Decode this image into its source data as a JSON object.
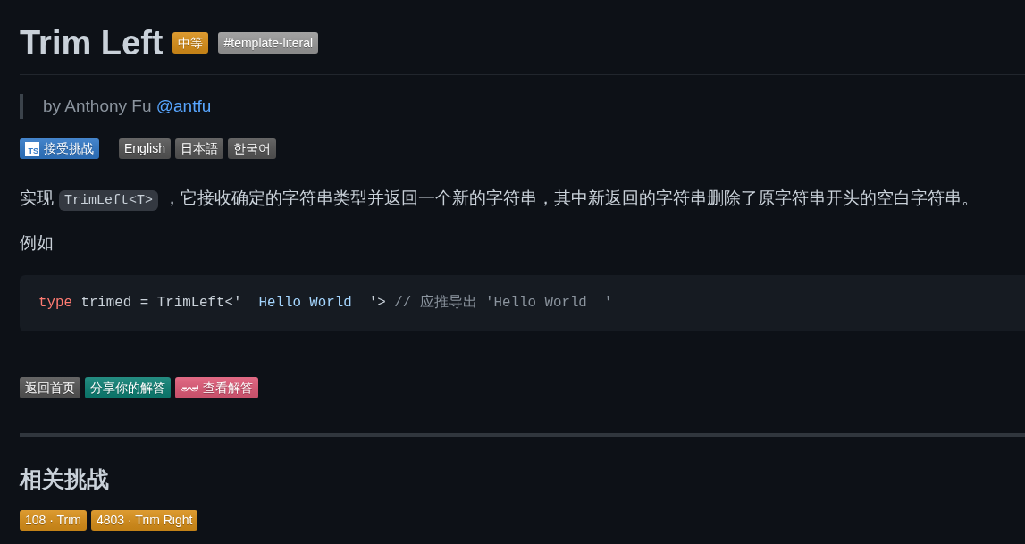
{
  "title": "Trim Left",
  "difficulty_badge": {
    "text": "中等",
    "color": "#d9901a"
  },
  "tag_badge": {
    "text": "#template-literal",
    "color": "#999999"
  },
  "author": {
    "prefix": "by Anthony Fu",
    "handle": "@antfu"
  },
  "challenge_button": {
    "logo_text": "TS",
    "text": "接受挑战",
    "color": "#3178c6"
  },
  "languages": [
    {
      "text": "English",
      "color": "#555555"
    },
    {
      "text": "日本語",
      "color": "#555555"
    },
    {
      "text": "한국어",
      "color": "#555555"
    }
  ],
  "description": [
    {
      "kind": "text",
      "text": "实现"
    },
    {
      "kind": "code",
      "text": "TrimLeft<T>"
    },
    {
      "kind": "text",
      "text": "，它接收确定的字符串类型并返回一个新的字符串，其中新返回的字符串删除了原字符串开头的空白字符串。"
    }
  ],
  "example_label": "例如",
  "code_block": {
    "tokens": [
      {
        "kind": "keyword",
        "text": "type"
      },
      {
        "kind": "plain",
        "text": " trimed = TrimLeft<'"
      },
      {
        "kind": "string",
        "text": "  Hello World  "
      },
      {
        "kind": "plain",
        "text": "'> "
      },
      {
        "kind": "comment",
        "text": "// 应推导出 'Hello World  '"
      }
    ]
  },
  "buttons": [
    {
      "kind": "plain",
      "text": "返回首页",
      "color": "#555555"
    },
    {
      "kind": "plain",
      "text": "分享你的解答",
      "color": "#0d8074"
    },
    {
      "kind": "glasses",
      "text": "查看解答",
      "color": "#de5a77"
    }
  ],
  "related": {
    "heading": "相关挑战",
    "items": [
      {
        "text": "108 · Trim",
        "color": "#d9901a"
      },
      {
        "text": "4803 · Trim Right",
        "color": "#d9901a"
      }
    ]
  }
}
